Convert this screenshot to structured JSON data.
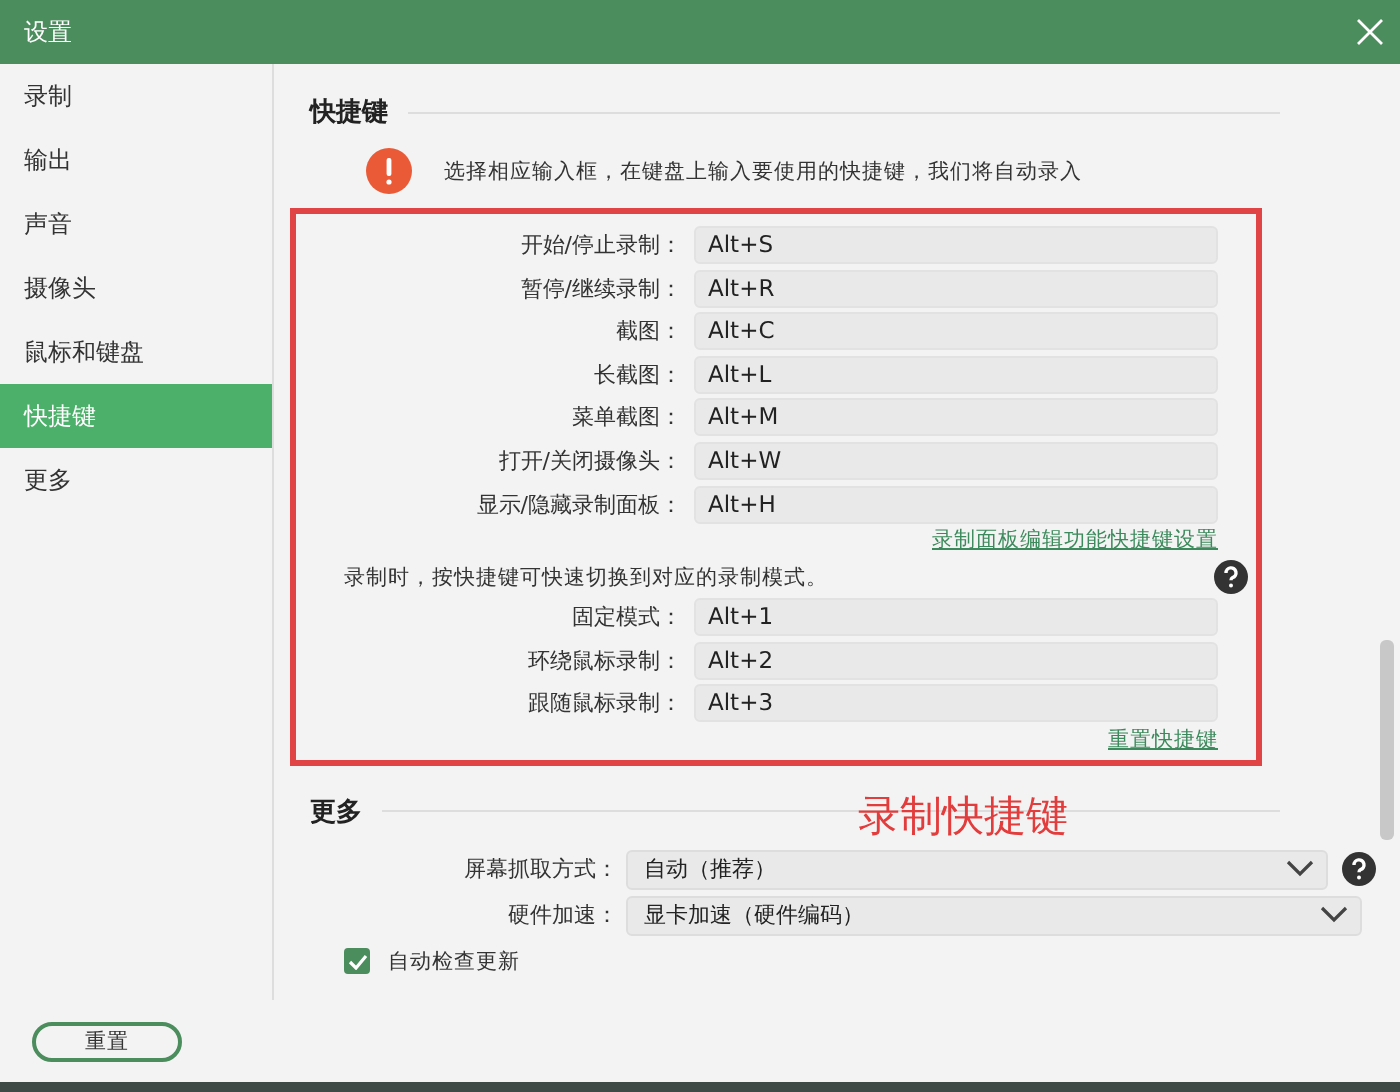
{
  "window": {
    "title": "设置"
  },
  "sidebar": {
    "items": [
      {
        "label": "录制",
        "selected": false
      },
      {
        "label": "输出",
        "selected": false
      },
      {
        "label": "声音",
        "selected": false
      },
      {
        "label": "摄像头",
        "selected": false
      },
      {
        "label": "鼠标和键盘",
        "selected": false
      },
      {
        "label": "快捷键",
        "selected": true
      },
      {
        "label": "更多",
        "selected": false
      }
    ]
  },
  "shortcuts": {
    "heading": "快捷键",
    "notice": "选择相应输入框，在键盘上输入要使用的快捷键，我们将自动录入",
    "actions": [
      {
        "label": "开始/停止录制：",
        "value": "Alt+S"
      },
      {
        "label": "暂停/继续录制：",
        "value": "Alt+R"
      },
      {
        "label": "截图：",
        "value": "Alt+C"
      },
      {
        "label": "长截图：",
        "value": "Alt+L"
      },
      {
        "label": "菜单截图：",
        "value": "Alt+M"
      },
      {
        "label": "打开/关闭摄像头：",
        "value": "Alt+W"
      },
      {
        "label": "显示/隐藏录制面板：",
        "value": "Alt+H"
      }
    ],
    "panel_link": "录制面板编辑功能快捷键设置",
    "mode_note": "录制时，按快捷键可快速切换到对应的录制模式。",
    "modes": [
      {
        "label": "固定模式：",
        "value": "Alt+1"
      },
      {
        "label": "环绕鼠标录制：",
        "value": "Alt+2"
      },
      {
        "label": "跟随鼠标录制：",
        "value": "Alt+3"
      }
    ],
    "reset_link": "重置快捷键"
  },
  "annotation": {
    "text": "录制快捷键"
  },
  "more": {
    "heading": "更多",
    "selects": [
      {
        "label": "屏幕抓取方式：",
        "value": "自动（推荐）",
        "help": true
      },
      {
        "label": "硬件加速：",
        "value": "显卡加速（硬件编码）",
        "help": false
      }
    ],
    "auto_update": {
      "label": "自动检查更新",
      "checked": true
    }
  },
  "footer": {
    "reset_button": "重置"
  }
}
